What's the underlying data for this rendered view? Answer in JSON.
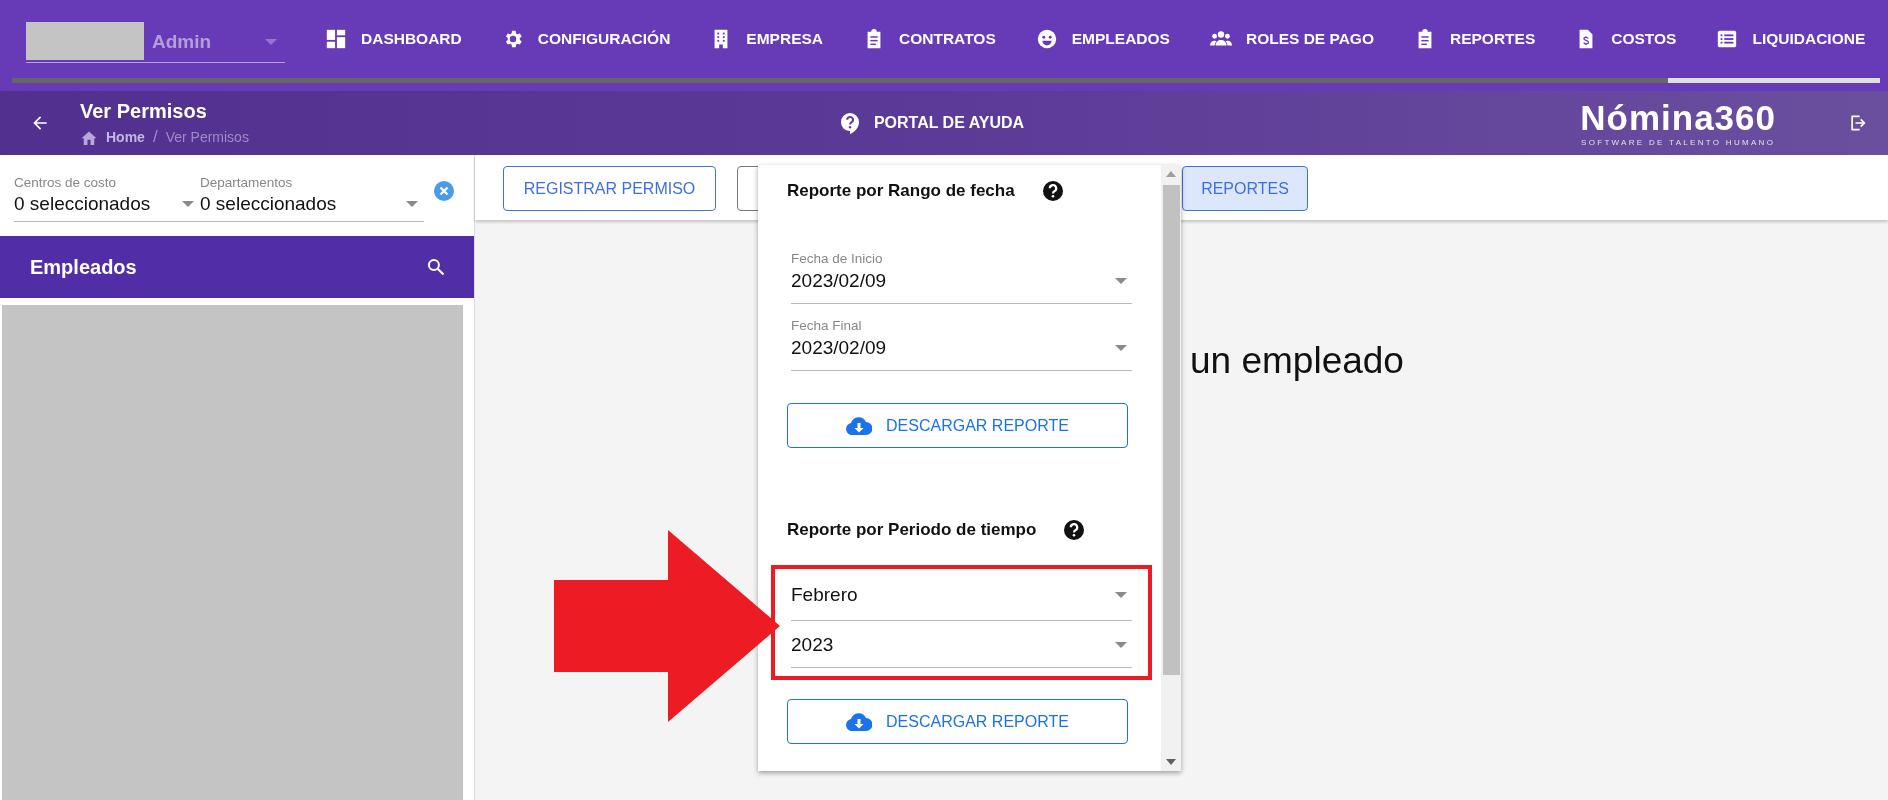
{
  "nav": {
    "account": {
      "label": "Admin"
    },
    "items": [
      {
        "label": "DASHBOARD"
      },
      {
        "label": "CONFIGURACIÓN"
      },
      {
        "label": "EMPRESA"
      },
      {
        "label": "CONTRATOS"
      },
      {
        "label": "EMPLEADOS"
      },
      {
        "label": "ROLES DE PAGO"
      },
      {
        "label": "REPORTES"
      },
      {
        "label": "COSTOS"
      },
      {
        "label": "LIQUIDACIONE"
      }
    ]
  },
  "header": {
    "title": "Ver Permisos",
    "breadcrumb": [
      {
        "label": "Home"
      },
      {
        "label": "Ver Permisos"
      }
    ],
    "breadcrumb_separator": "/",
    "help_link": "PORTAL DE AYUDA",
    "logo": {
      "name": "Nómina360",
      "tagline": "SOFTWARE DE TALENTO HUMANO"
    }
  },
  "filters": [
    {
      "label": "Centros de costo",
      "value": "0 seleccionados"
    },
    {
      "label": "Departamentos",
      "value": "0 seleccionados"
    }
  ],
  "employees_panel": {
    "title": "Empleados"
  },
  "toolbar": {
    "buttons": [
      {
        "label": "REGISTRAR PERMISO",
        "selected": false
      },
      {
        "selected": false
      },
      {
        "label": "REPORTES",
        "selected": true
      }
    ]
  },
  "main_message": "un empleado",
  "report_popup": {
    "sections": [
      {
        "title": "Reporte por Rango de fecha",
        "highlighted": false,
        "fields": [
          {
            "label": "Fecha de Inicio",
            "value": "2023/02/09"
          },
          {
            "label": "Fecha Final",
            "value": "2023/02/09"
          }
        ],
        "button": "DESCARGAR REPORTE"
      },
      {
        "title": "Reporte por Periodo de tiempo",
        "highlighted": true,
        "fields": [
          {
            "value": "Febrero"
          },
          {
            "value": "2023"
          }
        ],
        "button": "DESCARGAR REPORTE"
      }
    ]
  }
}
